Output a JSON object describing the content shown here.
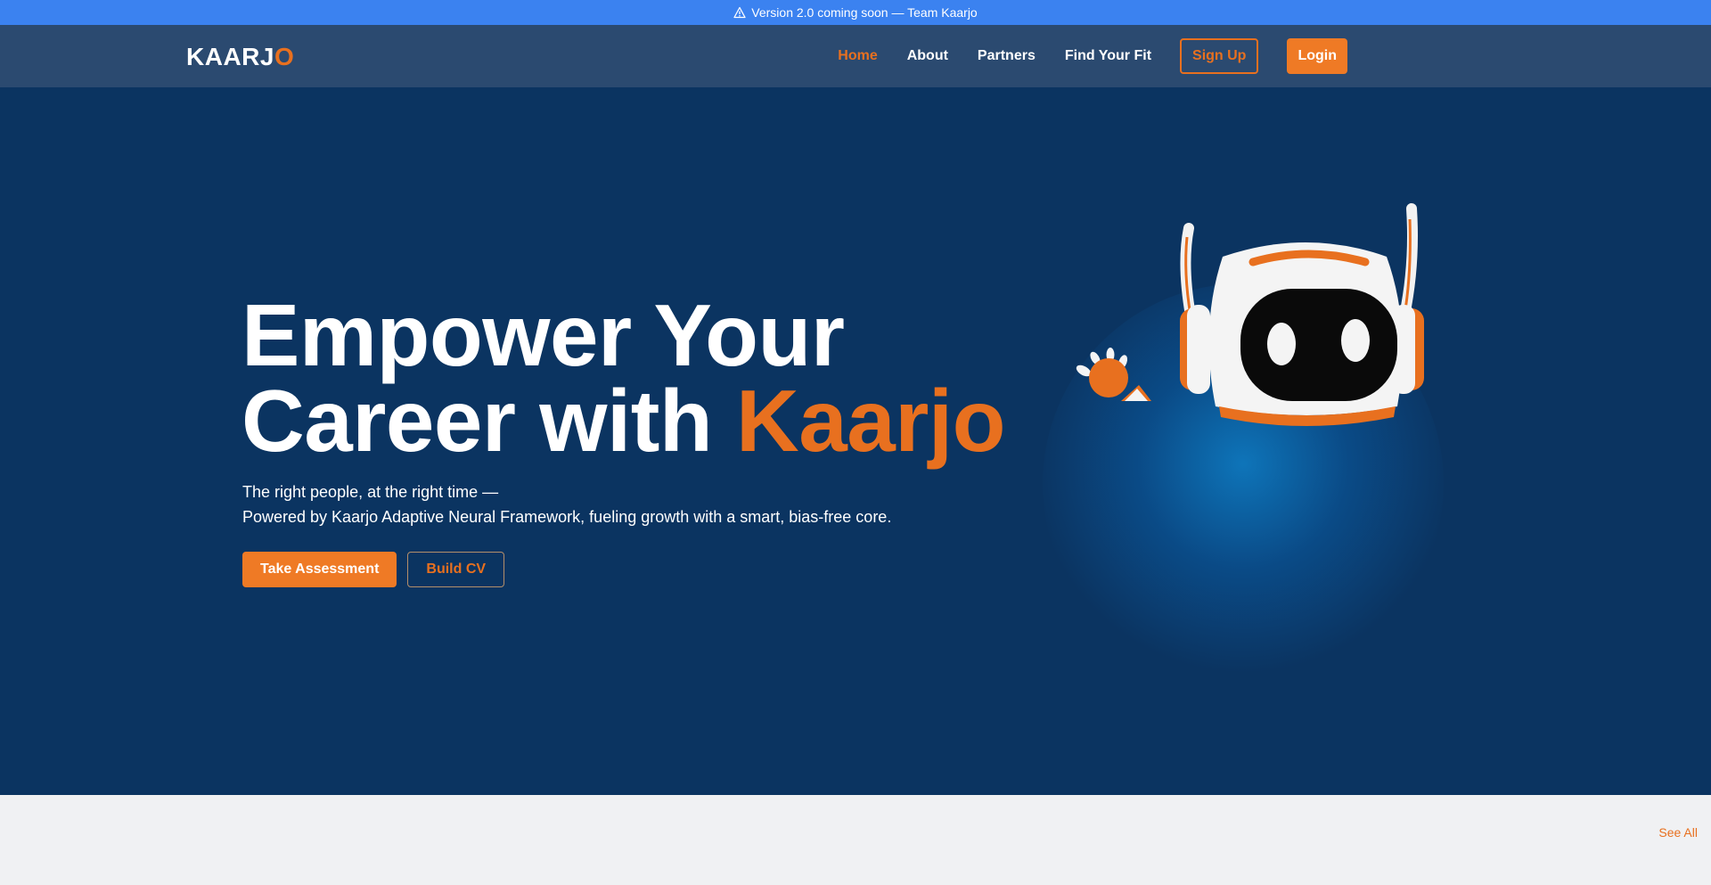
{
  "announcement": {
    "icon": "warning-triangle-icon",
    "text": "Version 2.0 coming soon — Team Kaarjo"
  },
  "nav": {
    "logo_main": "KAARJ",
    "logo_accent": "O",
    "links": [
      {
        "label": "Home",
        "active": true
      },
      {
        "label": "About",
        "active": false
      },
      {
        "label": "Partners",
        "active": false
      },
      {
        "label": "Find Your Fit",
        "active": false
      }
    ],
    "signup_label": "Sign Up",
    "login_label": "Login"
  },
  "hero": {
    "title_line1": "Empower Your",
    "title_line2_prefix": "Career with ",
    "title_accent": "Kaarjo",
    "subtitle_line1": "The right people, at the right time —",
    "subtitle_line2": "Powered by Kaarjo Adaptive Neural Framework, fueling growth with a smart, bias-free core.",
    "primary_cta": "Take Assessment",
    "secondary_cta": "Build CV",
    "illustration": "robot-mascot-icon"
  },
  "section": {
    "see_all_label": "See All"
  },
  "colors": {
    "announcement_bg": "#3b82f0",
    "nav_bg": "#2b4a70",
    "hero_bg": "#0b3461",
    "accent": "#e8701f",
    "lower_bg": "#f0f1f3"
  }
}
